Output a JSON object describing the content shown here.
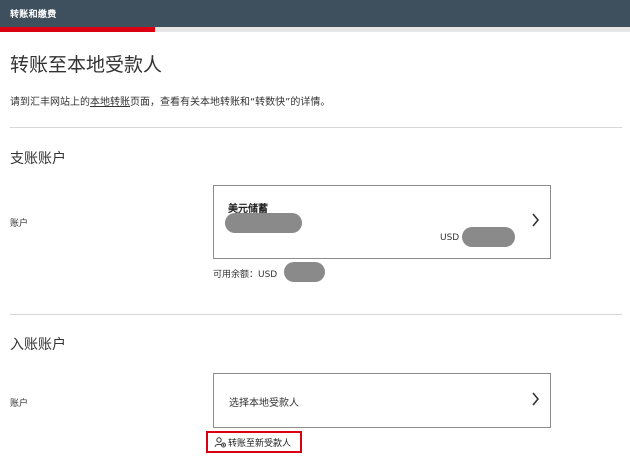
{
  "header": {
    "title": "转账和缴费"
  },
  "page": {
    "title": "转账至本地受款人",
    "intro_before": "请到汇丰网站上的",
    "intro_link": "本地转账",
    "intro_after": "页面，查看有关本地转账和“转数快”的详情。"
  },
  "from_section": {
    "title": "支账账户",
    "field_label": "账户",
    "account_name": "美元储蓄",
    "currency": "USD",
    "available_label": "可用余额：USD"
  },
  "to_section": {
    "title": "入账账户",
    "field_label": "账户",
    "payee_placeholder": "选择本地受款人",
    "new_payee_label": "转账至新受款人"
  },
  "colors": {
    "header_bg": "#3e505d",
    "accent_red": "#db0011",
    "mask_gray": "#8a8a8a"
  },
  "icons": {
    "chevron": "chevron-right-icon",
    "new_payee": "add-person-icon"
  }
}
